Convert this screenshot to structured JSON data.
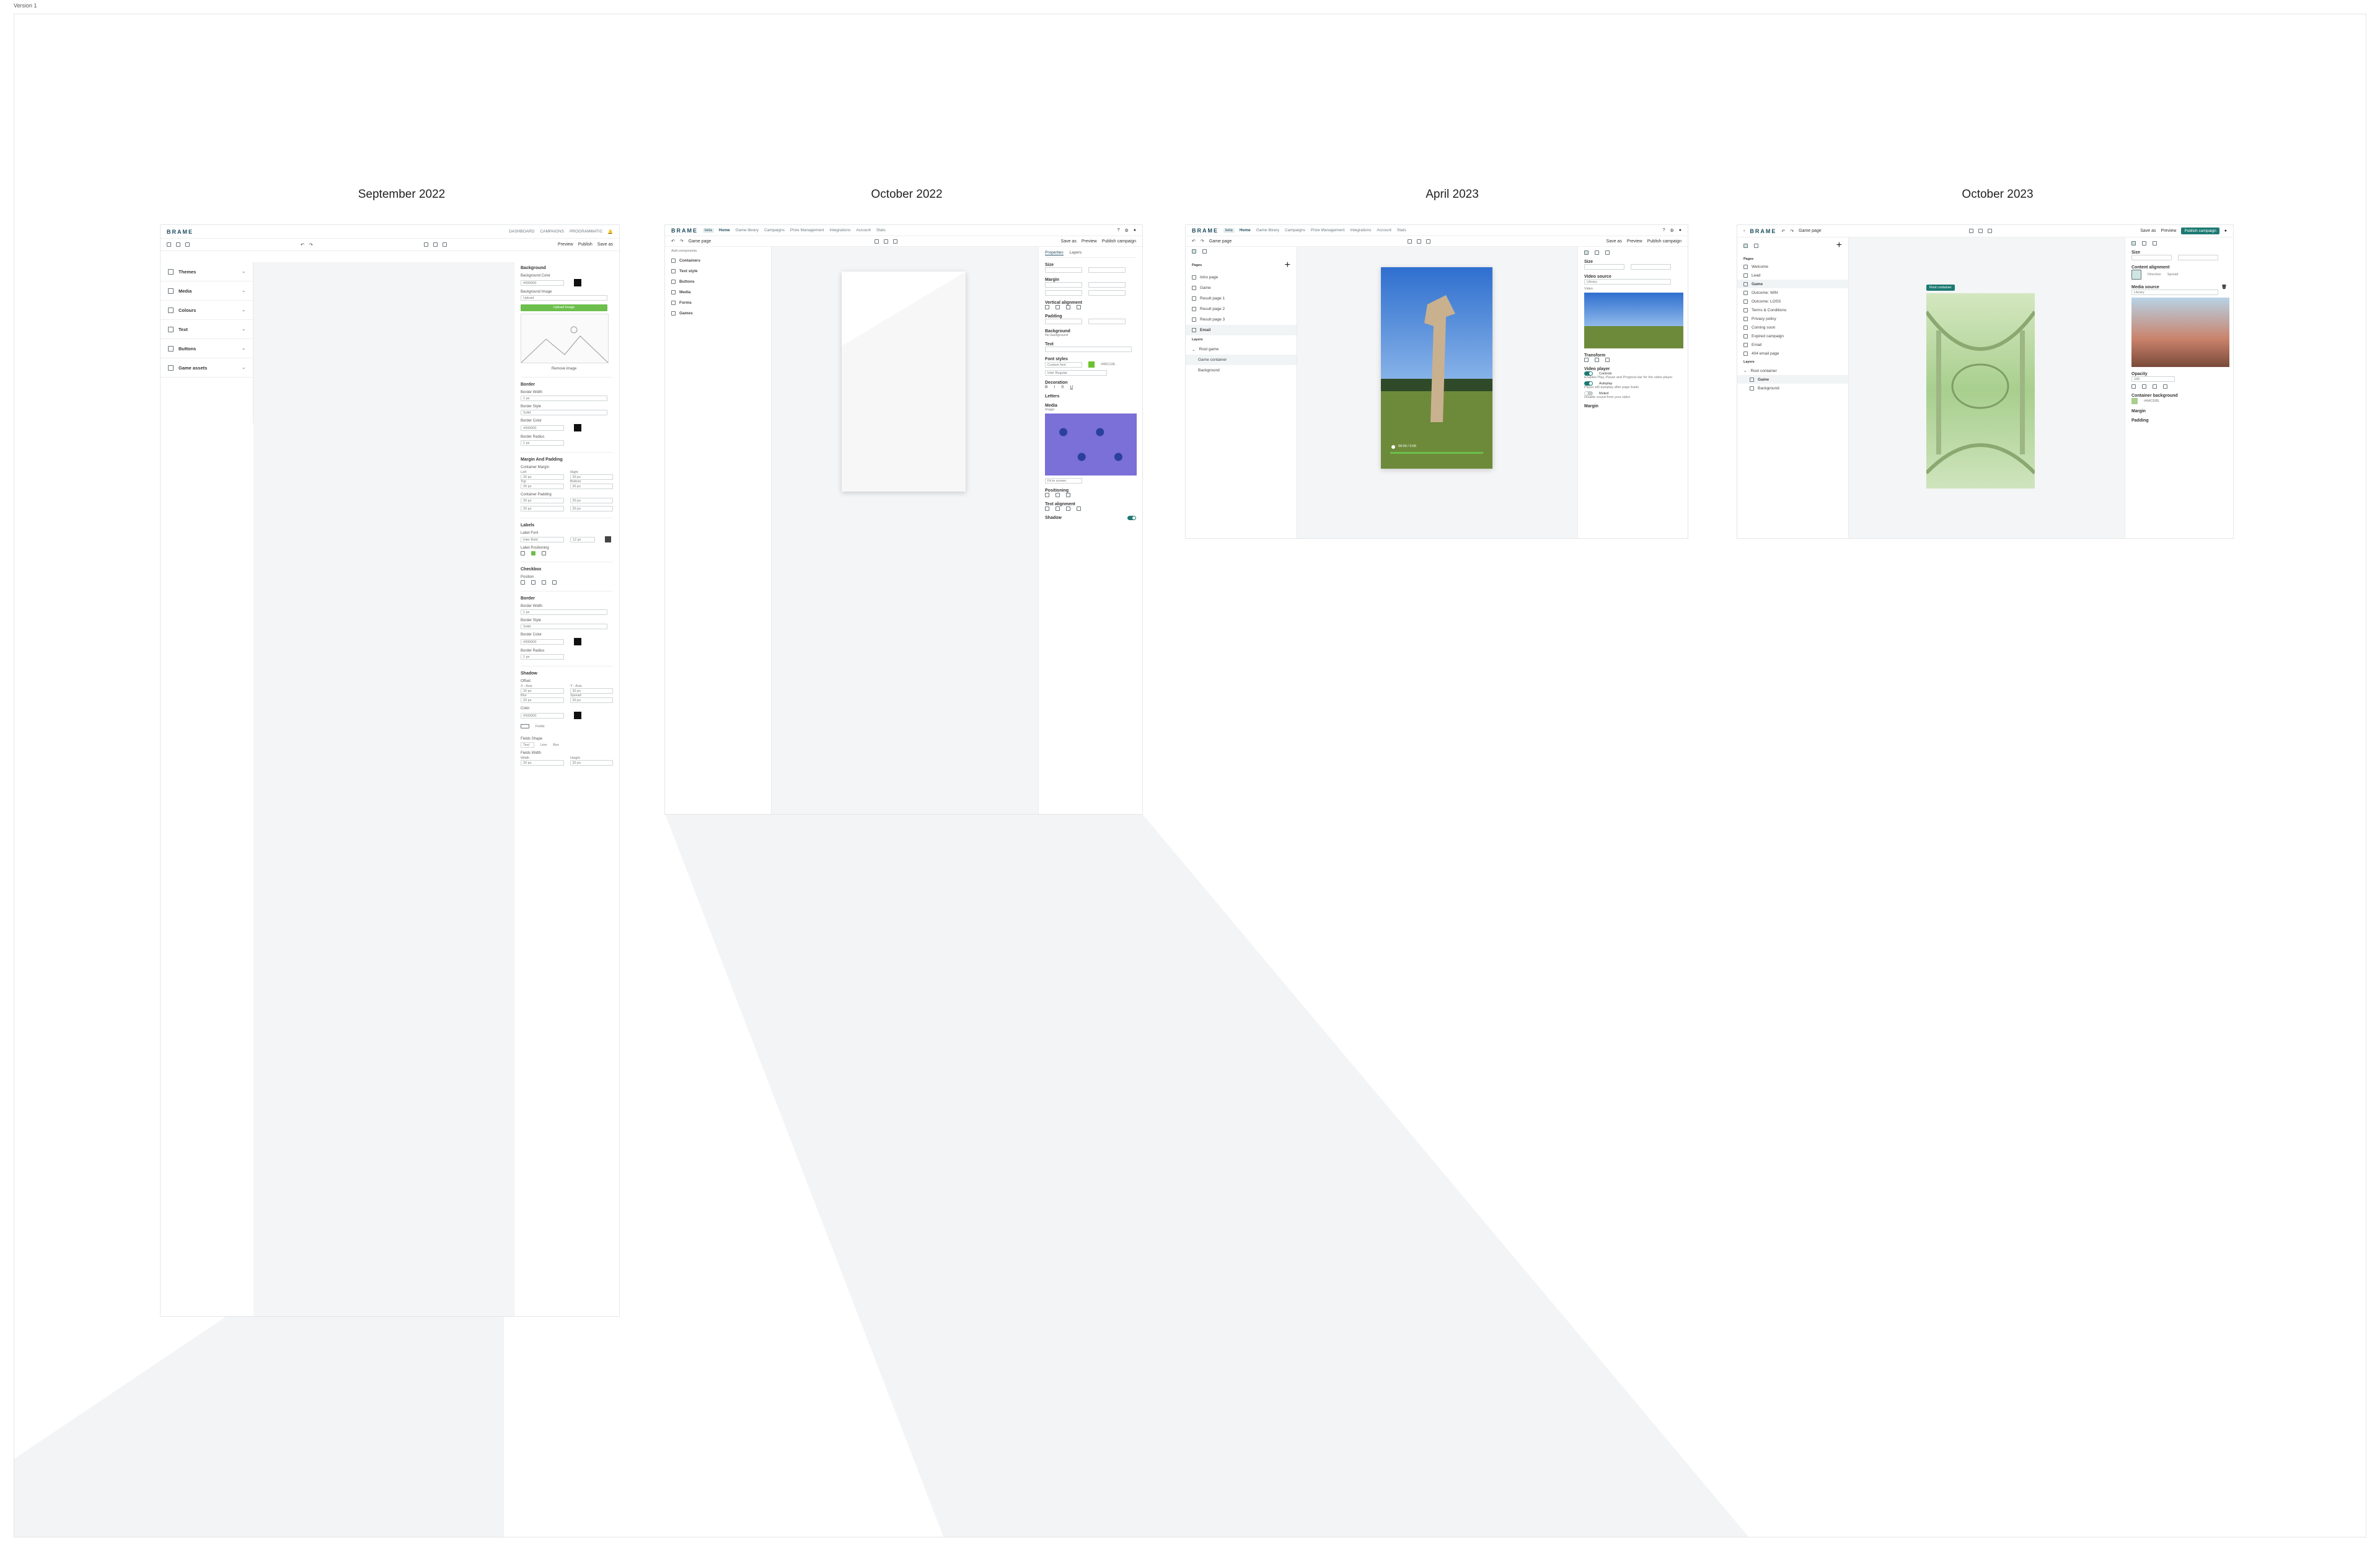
{
  "canvas": {
    "label": "Version 1"
  },
  "columns": [
    {
      "title": "September 2022"
    },
    {
      "title": "October 2022"
    },
    {
      "title": "April 2023"
    },
    {
      "title": "October 2023"
    }
  ],
  "sep2022": {
    "brand": "BRAME",
    "nav": [
      "DASHBOARD",
      "CAMPAIGNS",
      "PROGRAMMATIC"
    ],
    "toolbar": {
      "preview": "Preview",
      "publish": "Publish",
      "save_as": "Save as"
    },
    "sidebar": [
      "Themes",
      "Media",
      "Colours",
      "Text",
      "Buttons",
      "Game assets"
    ],
    "panel": {
      "background": "Background",
      "background_color": "Background Color",
      "background_color_value": "#000000",
      "background_image": "Background Image",
      "background_image_value": "Upload",
      "upload_button": "Upload Image",
      "remove_image": "Remove image",
      "border": "Border",
      "border_width": "Border Width",
      "border_width_value": "1 px",
      "border_style": "Border Style",
      "border_style_value": "Solid",
      "border_color": "Border Color",
      "border_color_value": "#000000",
      "border_radius": "Border Radius",
      "border_radius_value": "1 px",
      "margin_padding": "Margin And Padding",
      "container_margin": "Container Margin",
      "left": "Left",
      "right": "Right",
      "top": "Top",
      "bottom": "Bottom",
      "px_value": "20 px",
      "container_padding": "Container Padding",
      "labels": "Labels",
      "label_font": "Label Font",
      "label_font_value": "Inter Bold",
      "label_size_value": "12 px",
      "label_positioning": "Label Positioning",
      "checkbox": "Checkbox",
      "position": "Position",
      "border2": "Border",
      "shadow": "Shadow",
      "offset": "Offset",
      "x_axis": "X - Axis",
      "y_axis": "Y - Axis",
      "blur": "Blur",
      "spread": "Spread",
      "color": "Color",
      "color_value": "#000000",
      "fields": "Fields",
      "fields_shape": "Fields Shape",
      "shape_options": [
        "Text",
        "Line",
        "Box"
      ],
      "fields_width": "Fields Width",
      "width": "Width",
      "height": "Height"
    }
  },
  "oct2022": {
    "brand": "BRAME",
    "badge": "beta",
    "nav": [
      "Home",
      "Game library",
      "Campaigns",
      "Prize Management",
      "Integrations",
      "Account",
      "Stats"
    ],
    "page_select": "Game page",
    "toolbar": {
      "save_as": "Save as",
      "preview": "Preview",
      "publish": "Publish campaign"
    },
    "add_components": "Add components",
    "components": [
      "Containers",
      "Text style",
      "Buttons",
      "Media",
      "Forms",
      "Games"
    ],
    "tabs": [
      "Properties",
      "Layers"
    ],
    "panel": {
      "size": "Size",
      "margin": "Margin",
      "vertical_alignment": "Vertical alignment",
      "padding": "Padding",
      "background": "Background",
      "no_background": "No background",
      "text": "Text",
      "font_styles": "Font styles",
      "font_value": "Custom font",
      "color_value": "#6BC22E",
      "font_name": "Inter Regular",
      "decoration": "Decoration",
      "letters": "Letters",
      "media": "Media",
      "image": "Image",
      "fit": "Fit to screen",
      "positioning": "Positioning",
      "text_alignment": "Text alignment",
      "shadow": "Shadow"
    }
  },
  "apr2023": {
    "brand": "BRAME",
    "badge": "beta",
    "nav": [
      "Home",
      "Game library",
      "Campaigns",
      "Prize Management",
      "Integrations",
      "Account",
      "Stats"
    ],
    "page_select": "Game page",
    "toolbar": {
      "save_as": "Save as",
      "preview": "Preview",
      "publish": "Publish campaign"
    },
    "pages_title": "Pages",
    "pages": [
      "Intro page",
      "Game",
      "Result page 1",
      "Result page 2",
      "Result page 3",
      "Email"
    ],
    "layers_title": "Layers",
    "layers": [
      "Root game",
      "Game container",
      "Background"
    ],
    "video_time": "00:00 / 0:05",
    "panel": {
      "size": "Size",
      "video_source": "Video source",
      "video_source_value": "Library",
      "video": "Video",
      "transform": "Transform",
      "video_player": "Video player",
      "controls": "Controls",
      "controls_desc": "Enables Play, Pause and Progress bar for the video player",
      "autoplay": "Autoplay",
      "autoplay_desc": "Player will autoplay after page loads",
      "muted": "Muted",
      "muted_desc": "Disable sound from your video",
      "margin": "Margin"
    }
  },
  "oct2023": {
    "brand": "BRAME",
    "page_select": "Game page",
    "toolbar": {
      "save_as": "Save as",
      "preview": "Preview",
      "publish": "Publish campaign"
    },
    "pages_title": "Pages",
    "pages": [
      "Welcome",
      "Lead",
      "Game",
      "Outcome: WIN",
      "Outcome: LOSS",
      "Terms & Conditions",
      "Privacy policy",
      "Coming soon",
      "Expired campaign",
      "Email",
      "404 email page"
    ],
    "layers_title": "Layers",
    "layers": [
      "Root container",
      "Game",
      "Background"
    ],
    "tag": "Root container",
    "panel": {
      "size": "Size",
      "content_alignment": "Content alignment",
      "direction": "Direction",
      "spread": "Spread",
      "media_source": "Media source",
      "media_source_value": "Library",
      "opacity": "Opacity",
      "opacity_value": "100",
      "container_background": "Container background",
      "bg_value": "#AACE8E",
      "margin": "Margin",
      "padding": "Padding"
    }
  },
  "colors": {
    "accent": "#1d7a72",
    "brand": "#1d4c5e",
    "green": "#6cbf4c",
    "purple": "#7b6fd8"
  }
}
